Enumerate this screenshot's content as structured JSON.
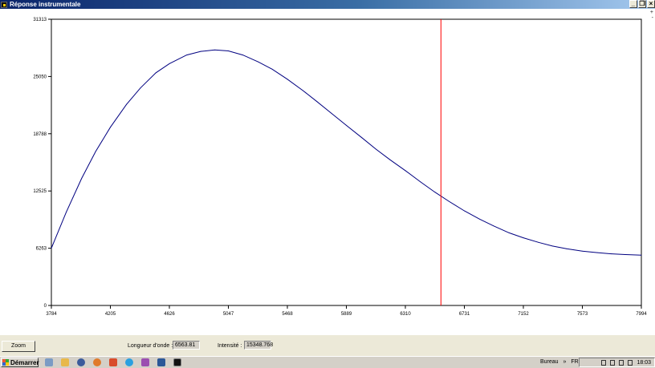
{
  "window": {
    "title": "Réponse instrumentale",
    "controls": [
      "minimize",
      "restore",
      "close"
    ],
    "side_marks": [
      "+",
      "-"
    ]
  },
  "chart_data": {
    "type": "line",
    "title": "",
    "xlabel": "",
    "ylabel": "",
    "xlim": [
      3784,
      7994
    ],
    "ylim": [
      0,
      31313
    ],
    "x_ticks": [
      "3784",
      "4205",
      "4626",
      "5047",
      "5468",
      "5889",
      "6310",
      "6731",
      "7152",
      "7573",
      "7994"
    ],
    "y_ticks": [
      "0",
      "6263",
      "12525",
      "18788",
      "25050",
      "31313"
    ],
    "grid": false,
    "series": [
      {
        "color": "#000080",
        "x": [
          3784,
          3890,
          4000,
          4100,
          4205,
          4320,
          4420,
          4530,
          4626,
          4750,
          4850,
          4950,
          5047,
          5150,
          5260,
          5360,
          5468,
          5580,
          5680,
          5780,
          5889,
          6000,
          6100,
          6200,
          6310,
          6420,
          6520,
          6620,
          6731,
          6840,
          6940,
          7050,
          7152,
          7260,
          7360,
          7460,
          7573,
          7680,
          7780,
          7880,
          7994
        ],
        "values": [
          6263,
          10200,
          13900,
          16850,
          19500,
          22000,
          23800,
          25450,
          26450,
          27400,
          27800,
          27950,
          27850,
          27400,
          26650,
          25850,
          24750,
          23500,
          22300,
          21050,
          19700,
          18350,
          17100,
          15950,
          14750,
          13500,
          12400,
          11400,
          10350,
          9450,
          8700,
          7950,
          7400,
          6900,
          6500,
          6200,
          5950,
          5780,
          5650,
          5570,
          5500
        ]
      }
    ],
    "cursor": {
      "x": 6563.81,
      "color": "#ff0000"
    }
  },
  "controls": {
    "zoom_label": "Zoom",
    "wavelength_label": "Longueur d'onde :",
    "wavelength_value": "6563.81",
    "intensity_label": "Intensité :",
    "intensity_value": "15348.768"
  },
  "taskbar": {
    "start_label": "Démarrer",
    "quick_launch": [
      "show-desktop-icon",
      "folder-icon",
      "media-icon",
      "firefox-icon",
      "shield-icon",
      "skype-icon",
      "paint-icon",
      "word-icon",
      "app-icon"
    ],
    "desktop_label": "Bureau",
    "chevron": "»",
    "language": "FR",
    "clock": "18:03"
  }
}
